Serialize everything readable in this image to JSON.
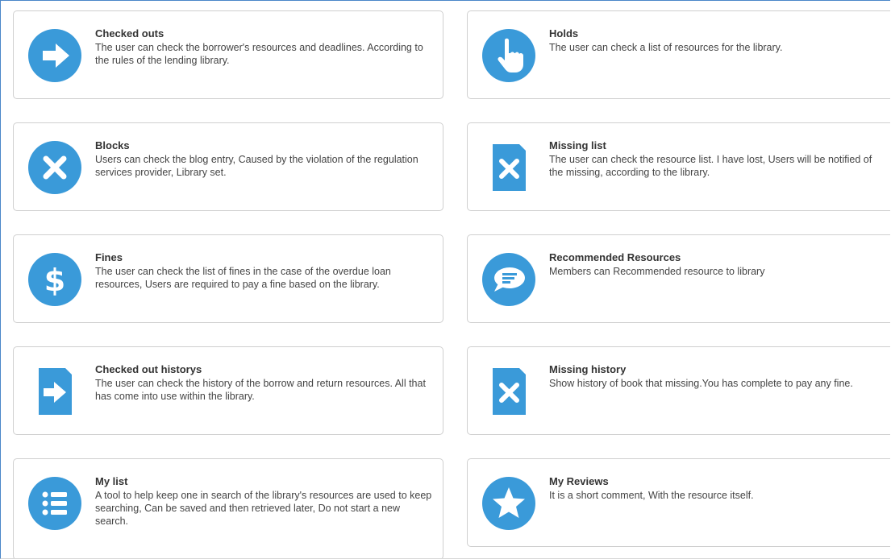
{
  "accent_color": "#3a9ad9",
  "cards": [
    {
      "title": "Checked outs",
      "icon": "arrow-right-circle-icon",
      "description": "The user can check the borrower's resources and deadlines. According to the rules of the lending library."
    },
    {
      "title": "Holds",
      "icon": "hand-pointer-icon",
      "description": "The user can check a list of resources for the library."
    },
    {
      "title": "Blocks",
      "icon": "x-circle-icon",
      "description": "Users can check the blog entry, Caused by the violation of the regulation services provider, Library set."
    },
    {
      "title": "Missing list",
      "icon": "x-file-icon",
      "description": "The user can check the resource list. I have lost, Users will be notified of the missing, according to the library."
    },
    {
      "title": "Fines",
      "icon": "dollar-circle-icon",
      "description": "The user can check the list of fines in the case of the overdue loan resources, Users are required to pay a fine based on the library."
    },
    {
      "title": "Recommended Resources",
      "icon": "comment-icon",
      "description": "Members can Recommended resource to library"
    },
    {
      "title": "Checked out historys",
      "icon": "arrow-right-file-icon",
      "description": "The user can check the history of the borrow and return resources. All that has come into use within the library."
    },
    {
      "title": "Missing history",
      "icon": "x-file-icon",
      "description": "Show history of book that missing.You has complete to pay any fine."
    },
    {
      "title": "My list",
      "icon": "list-circle-icon",
      "description": "A tool to help keep one in search of the library's resources are used to keep searching, Can be saved and then retrieved later, Do not start a new search."
    },
    {
      "title": "My Reviews",
      "icon": "star-circle-icon",
      "description": "It is a short comment, With the resource itself."
    }
  ]
}
